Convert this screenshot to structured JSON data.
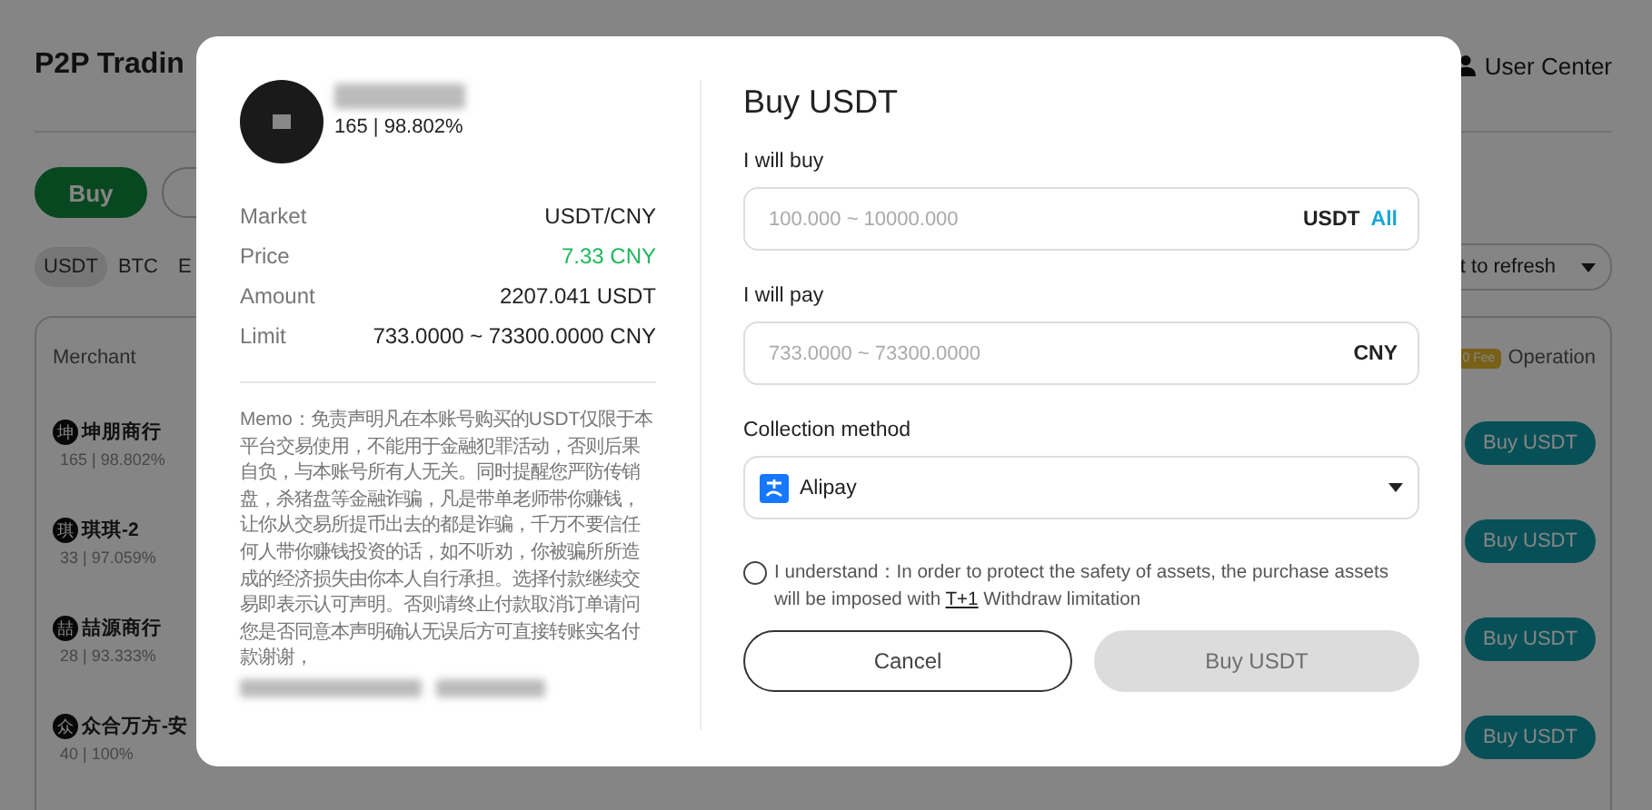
{
  "background": {
    "title": "P2P Tradin",
    "user_center": "User Center",
    "trade_tabs": [
      {
        "label": "Buy",
        "selected": true
      },
      {
        "selected": false
      }
    ],
    "coins": [
      {
        "label": "USDT",
        "selected": true
      },
      {
        "label": "BTC",
        "selected": false
      },
      {
        "label": "E",
        "selected": false
      }
    ],
    "refresh_select": "t to refresh",
    "table": {
      "merchant_column": "Merchant",
      "fee_badge": "0 Fee",
      "operation_column": "Operation",
      "rows": [
        {
          "avatar": "坤",
          "name": "坤朋商行",
          "stats": "165 | 98.802%",
          "action": "Buy USDT"
        },
        {
          "avatar": "琪",
          "name": "琪琪-2",
          "stats": "33 | 97.059%",
          "action": "Buy USDT"
        },
        {
          "avatar": "喆",
          "name": "喆源商行",
          "stats": "28 | 93.333%",
          "action": "Buy USDT"
        },
        {
          "avatar": "众",
          "name": "众合万方-安",
          "stats": "40 | 100%",
          "action": "Buy USDT"
        }
      ]
    }
  },
  "modal": {
    "merchant": {
      "stats": "165 | 98.802%"
    },
    "details": [
      {
        "label": "Market",
        "value": "USDT/CNY",
        "kind": "plain"
      },
      {
        "label": "Price",
        "value": "7.33 CNY",
        "kind": "price"
      },
      {
        "label": "Amount",
        "value": "2207.041 USDT",
        "kind": "plain"
      },
      {
        "label": "Limit",
        "value": "733.0000 ~ 73300.0000 CNY",
        "kind": "plain"
      }
    ],
    "memo": "Memo：免责声明凡在本账号购买的USDT仅限于本平台交易使用，不能用于金融犯罪活动，否则后果自负，与本账号所有人无关。同时提醒您严防传销盘，杀猪盘等金融诈骗，凡是带单老师带你赚钱，让你从交易所提币出去的都是诈骗，千万不要信任何人带你赚钱投资的话，如不听劝，你被骗所所造成的经济损失由你本人自行承担。选择付款继续交易即表示认可声明。否则请终止付款取消订单请问您是否同意本声明确认无误后方可直接转账实名付款谢谢，",
    "title": "Buy USDT",
    "buy_field": {
      "label": "I will buy",
      "placeholder": "100.000 ~ 10000.000",
      "unit": "USDT",
      "all": "All"
    },
    "pay_field": {
      "label": "I will pay",
      "placeholder": "733.0000 ~ 73300.0000",
      "unit": "CNY"
    },
    "collection": {
      "label": "Collection method",
      "value": "Alipay"
    },
    "agreement": {
      "checked": false,
      "text": "I understand：In order to protect the safety of assets, the purchase assets will be imposed with",
      "link": "T+1",
      "tail": "Withdraw limitation"
    },
    "buttons": [
      {
        "label": "Cancel",
        "kind": "cancel",
        "disabled": false
      },
      {
        "label": "Buy USDT",
        "kind": "submit",
        "disabled": true
      }
    ]
  }
}
